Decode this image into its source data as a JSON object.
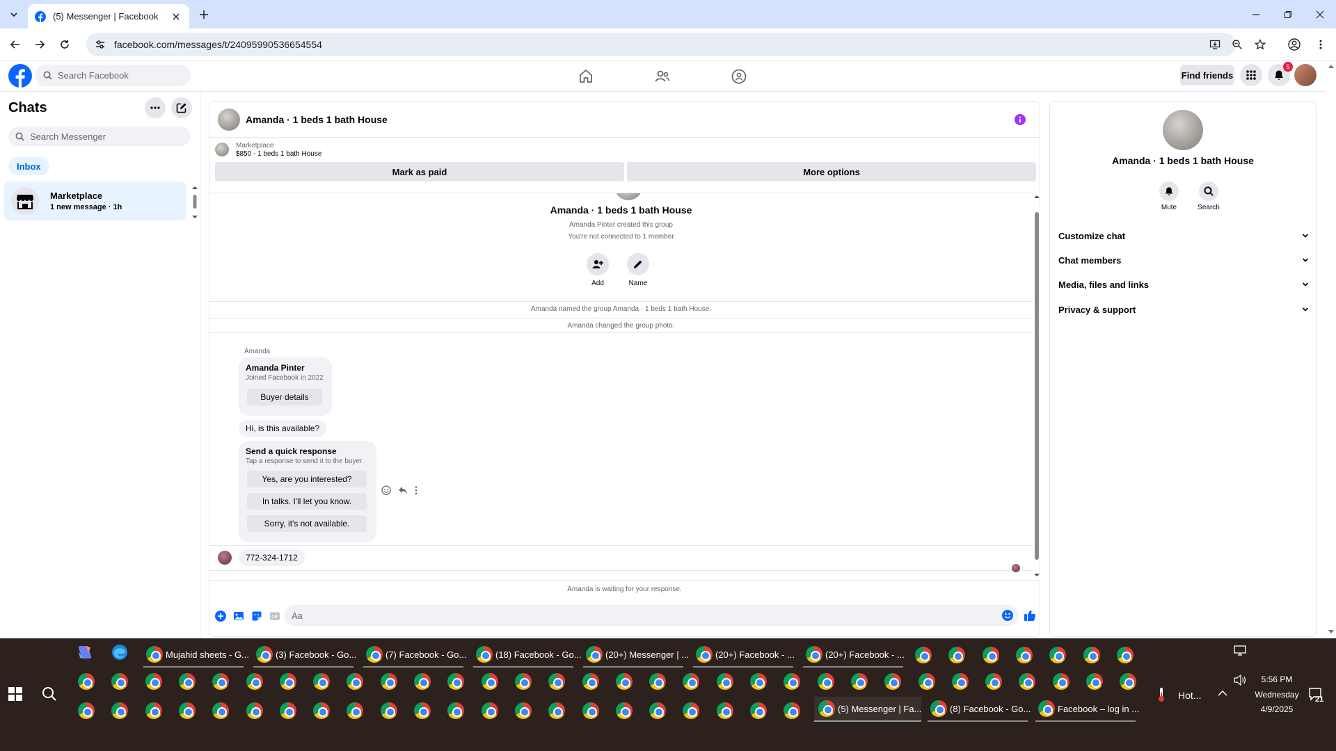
{
  "browser": {
    "tab_title": "(5) Messenger | Facebook",
    "url": "facebook.com/messages/t/24095990536654554"
  },
  "fb_header": {
    "search_placeholder": "Search Facebook",
    "find_friends": "Find friends",
    "notification_count": "5"
  },
  "sidebar": {
    "title": "Chats",
    "search_placeholder": "Search Messenger",
    "inbox_label": "Inbox",
    "chats": [
      {
        "name": "Marketplace",
        "preview": "1 new message · 1h"
      }
    ]
  },
  "conversation": {
    "title": "Amanda · 1 beds 1 bath House",
    "marketplace_label": "Marketplace",
    "listing": "$850 - 1 beds 1 bath House",
    "mark_paid": "Mark as paid",
    "more_options": "More options",
    "group_title": "Amanda · 1 beds 1 bath House",
    "created_by": "Amanda Pinter created this group",
    "not_connected": "You're not connected to 1 member",
    "actions": [
      {
        "label": "Add"
      },
      {
        "label": "Name"
      }
    ],
    "system_messages": [
      "Amanda named the group Amanda · 1 beds 1 bath House.",
      "Amanda changed the group photo."
    ],
    "sender_label": "Amanda",
    "buyer_card": {
      "name": "Amanda Pinter",
      "joined": "Joined Facebook in 2022",
      "button": "Buyer details"
    },
    "message_1": "Hi, is this available?",
    "quick_response": {
      "title": "Send a quick response",
      "subtitle": "Tap a response to send it to the buyer.",
      "options": [
        "Yes, are you interested?",
        "In talks. I'll let you know.",
        "Sorry, it's not available."
      ]
    },
    "message_2": "772-324-1712",
    "waiting": "Amanda is waiting for your response.",
    "composer_placeholder": "Aa"
  },
  "right_panel": {
    "title": "Amanda · 1 beds 1 bath House",
    "actions": [
      {
        "label": "Mute"
      },
      {
        "label": "Search"
      }
    ],
    "sections": [
      "Customize chat",
      "Chat members",
      "Media, files and links",
      "Privacy & support"
    ]
  },
  "taskbar": {
    "row1_apps": [
      "Mujahid sheets - G...",
      "(3) Facebook - Go...",
      "(7) Facebook - Go...",
      "(18) Facebook - Go...",
      "(20+) Messenger | ...",
      "(20+) Facebook - ...",
      "(20+) Facebook - ..."
    ],
    "row3_apps": [
      "(5) Messenger | Fa...",
      "(8) Facebook - Go...",
      "Facebook – log in ..."
    ],
    "weather": "Hot...",
    "time": "5:56 PM",
    "day": "Wednesday",
    "date": "4/9/2025",
    "notif_count": "21"
  },
  "colors": {
    "fb_blue": "#0866ff",
    "tab_strip": "#d3e3fd",
    "info_purple": "#a033ff",
    "taskbar_bg": "#2c211c"
  }
}
